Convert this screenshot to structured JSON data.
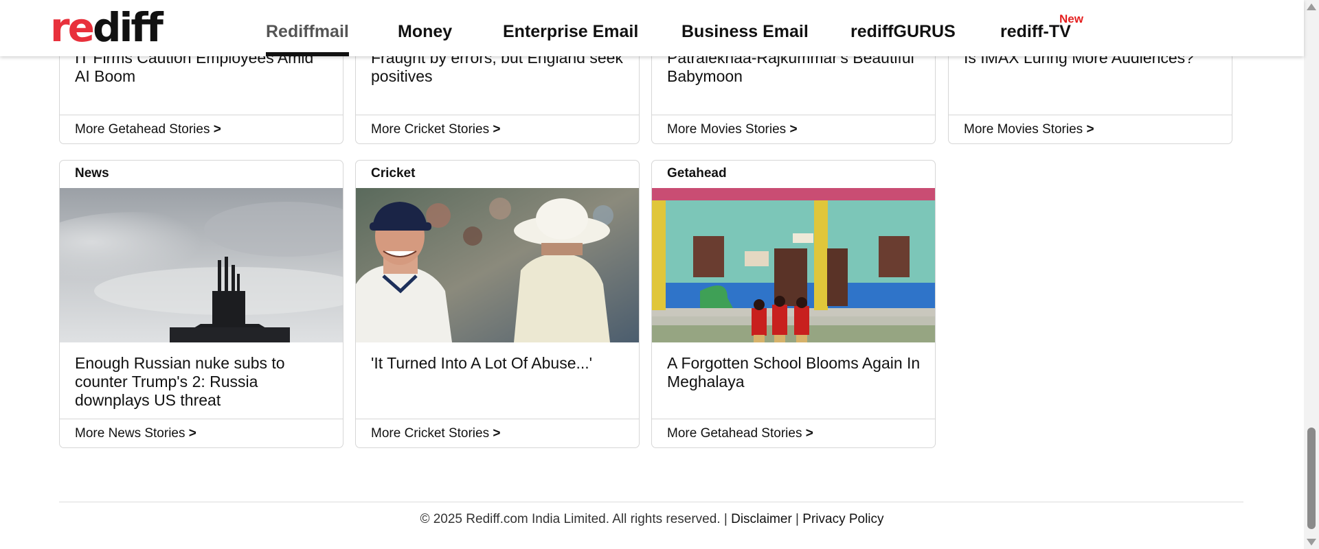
{
  "header": {
    "logo": {
      "part_red": "re",
      "part_dark": "diff"
    },
    "nav": [
      {
        "label": "Rediffmail",
        "active": true
      },
      {
        "label": "Money"
      },
      {
        "label": "Enterprise Email"
      },
      {
        "label": "Business Email"
      },
      {
        "label": "rediffGURUS"
      },
      {
        "label": "rediff-TV",
        "badge": "New"
      }
    ]
  },
  "top_cards": [
    {
      "headline": "IT Firms Caution Employees Amid AI Boom",
      "more": "More Getahead Stories"
    },
    {
      "headline": "Fraught by errors, but England seek positives",
      "more": "More Cricket Stories"
    },
    {
      "headline": "Patralekhaa-Rajkummar's Beautiful Babymoon",
      "more": "More Movies Stories"
    },
    {
      "headline": "Is IMAX Luring More Audiences?",
      "more": "More Movies Stories"
    }
  ],
  "cards": [
    {
      "category": "News",
      "headline": "Enough Russian nuke subs to counter Trump's 2: Russia downplays US threat",
      "more": "More News Stories",
      "image_icon": "submarine-image"
    },
    {
      "category": "Cricket",
      "headline": "'It Turned Into A Lot Of Abuse...'",
      "more": "More Cricket Stories",
      "image_icon": "cricketers-image"
    },
    {
      "category": "Getahead",
      "headline": "A Forgotten School Blooms Again In Meghalaya",
      "more": "More Getahead Stories",
      "image_icon": "school-image"
    }
  ],
  "more_arrow": ">",
  "footer": {
    "copyright": "© 2025 Rediff.com India Limited. All rights reserved. | ",
    "disclaimer": "Disclaimer",
    "separator": " | ",
    "privacy": "Privacy Policy"
  },
  "colors": {
    "brand_red": "#e8313c",
    "new_badge": "#e41f1f",
    "border": "#d6d6d6"
  }
}
